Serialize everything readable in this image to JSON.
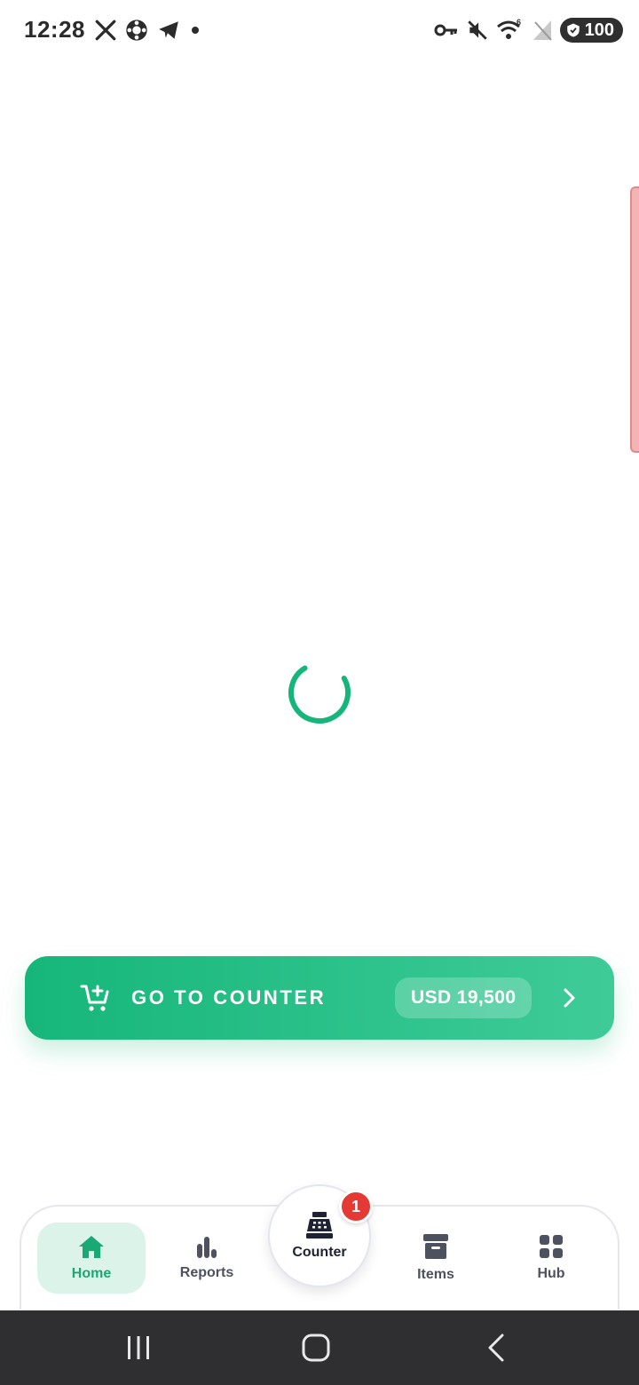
{
  "status_bar": {
    "time": "12:28",
    "left_icons": [
      "x-icon",
      "app-icon",
      "telegram-icon",
      "dot-icon"
    ],
    "right_icons": [
      "key-icon",
      "mute-icon",
      "wifi-icon",
      "no-signal-icon"
    ],
    "wifi_label": "6",
    "battery": "100"
  },
  "counter_cta": {
    "label": "GO TO COUNTER",
    "amount": "USD 19,500",
    "icon": "cart-add-icon"
  },
  "bottom_nav": {
    "home": "Home",
    "reports": "Reports",
    "counter": "Counter",
    "counter_badge": "1",
    "items": "Items",
    "hub": "Hub"
  },
  "colors": {
    "accent": "#16b67a",
    "badge": "#e53935",
    "home_active_bg": "#dcf3ea"
  }
}
